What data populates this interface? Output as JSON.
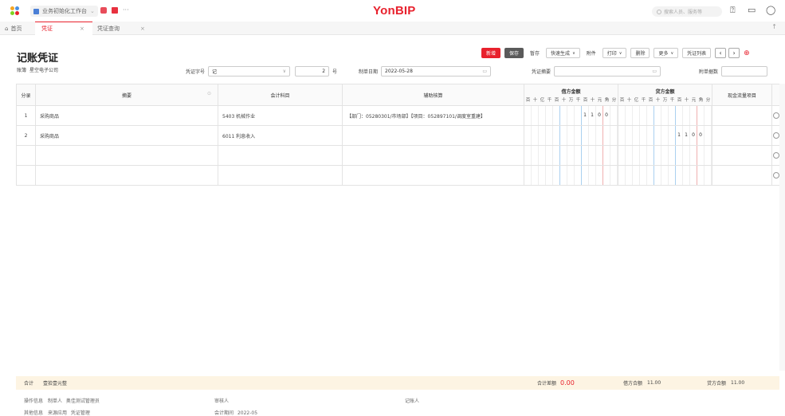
{
  "topbar": {
    "workspace": "业务初始化工作台",
    "brand": "YonBIP",
    "search_placeholder": "搜索人员、服务等",
    "more": "···"
  },
  "tabs": [
    {
      "label": "首页"
    },
    {
      "label": "凭证",
      "close": "×"
    },
    {
      "label": "凭证查询",
      "close": "×"
    }
  ],
  "page": {
    "title": "记账凭证",
    "account_book_label": "账簿",
    "account_book": "星空电子公司",
    "voucher_no_label": "凭证字号",
    "voucher_type": "记",
    "voucher_number": "2",
    "voucher_no_unit": "号",
    "date_label": "制单日期",
    "date": "2022-05-28",
    "summary_label": "凭证摘要",
    "attach_label": "附单据数"
  },
  "toolbar": {
    "new": "新增",
    "save": "保存",
    "draft": "暂存",
    "quick_gen": "快速生成",
    "attachment": "附件",
    "print": "打印",
    "delete": "删除",
    "more": "更多",
    "list": "凭证列表"
  },
  "table": {
    "headers": {
      "entry": "分录",
      "summary": "摘要",
      "account": "会计科目",
      "aux": "辅助核算",
      "debit": "借方金额",
      "credit": "贷方金额",
      "cashflow": "现金流量项目"
    },
    "digits": [
      "百",
      "十",
      "亿",
      "千",
      "百",
      "十",
      "万",
      "千",
      "百",
      "十",
      "元",
      "角",
      "分"
    ],
    "rows": [
      {
        "no": "1",
        "summary": "采购商品",
        "account": "5403 机械作业",
        "aux": "【部门：05280301/市场部】【项目：052897101/调度室重建】",
        "debit": [
          "",
          "",
          "",
          "",
          "",
          "",
          "",
          "",
          "1",
          "1",
          "0",
          "0",
          ""
        ],
        "credit": [
          "",
          "",
          "",
          "",
          "",
          "",
          "",
          "",
          "",
          "",
          "",
          "",
          ""
        ]
      },
      {
        "no": "2",
        "summary": "采购商品",
        "account": "6011 利息收入",
        "aux": "",
        "debit": [
          "",
          "",
          "",
          "",
          "",
          "",
          "",
          "",
          "",
          "",
          "",
          "",
          ""
        ],
        "credit": [
          "",
          "",
          "",
          "",
          "",
          "",
          "",
          "",
          "1",
          "1",
          "0",
          "0",
          ""
        ]
      },
      {
        "no": "",
        "summary": "",
        "account": "",
        "aux": "",
        "debit": [],
        "credit": []
      },
      {
        "no": "",
        "summary": "",
        "account": "",
        "aux": "",
        "debit": [],
        "credit": []
      }
    ]
  },
  "footer": {
    "total_label": "合计",
    "total_words": "壹拾壹元整",
    "diff_label": "合计差额",
    "diff_value": "0.00",
    "debit_total_label": "借方合额",
    "debit_total": "11.00",
    "credit_total_label": "贷方合额",
    "credit_total": "11.00"
  },
  "info": {
    "op_label": "操作信息",
    "maker_label": "制单人",
    "maker": "奥佳测试管理员",
    "auditor_label": "审核人",
    "booker_label": "记账人",
    "other_label": "其他信息",
    "source_label": "来源应用",
    "source": "凭证管理",
    "period_label": "会计期间",
    "period": "2022-05"
  }
}
